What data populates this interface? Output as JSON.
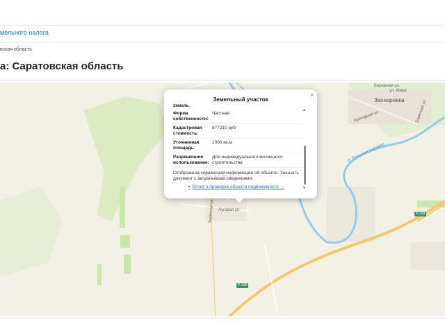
{
  "nav": {
    "link": "мельного налога"
  },
  "breadcrumb": "вская область",
  "page_title": "а: Саратовская область",
  "map": {
    "streets": [
      "Бережная ул.",
      "ул. Мира",
      "Бригадная ул.",
      "Заречная ул.",
      "р. Большая Караман",
      "Луговая ул.",
      "Заречная ул."
    ],
    "town": "Звонаревка",
    "roads": [
      "Р-229",
      "Р-229"
    ],
    "colors": {
      "land": "#f3f1e6",
      "forest": "#c9e7a8",
      "river": "#8ecdf0",
      "highway": "#f1c96b"
    }
  },
  "popup": {
    "title": "Земельный участок",
    "close": "×",
    "cut_label": "Земель.",
    "rows": [
      {
        "label": "Форма собственности:",
        "value": "Частная"
      },
      {
        "label": "Кадастровая стоимость:",
        "value": "877210 руб"
      },
      {
        "label": "Уточненная площадь:",
        "value": "1000 кв.м"
      },
      {
        "label": "Разрешенное использование:",
        "value": "Для индивидуального жилищного строительства"
      }
    ],
    "note": "Отображена справочная информация об объекте. Заказать документ с актуальными сведениями:",
    "link": "Отчет о проверке объекта недвижимости →",
    "watermark": "LEVEL"
  }
}
